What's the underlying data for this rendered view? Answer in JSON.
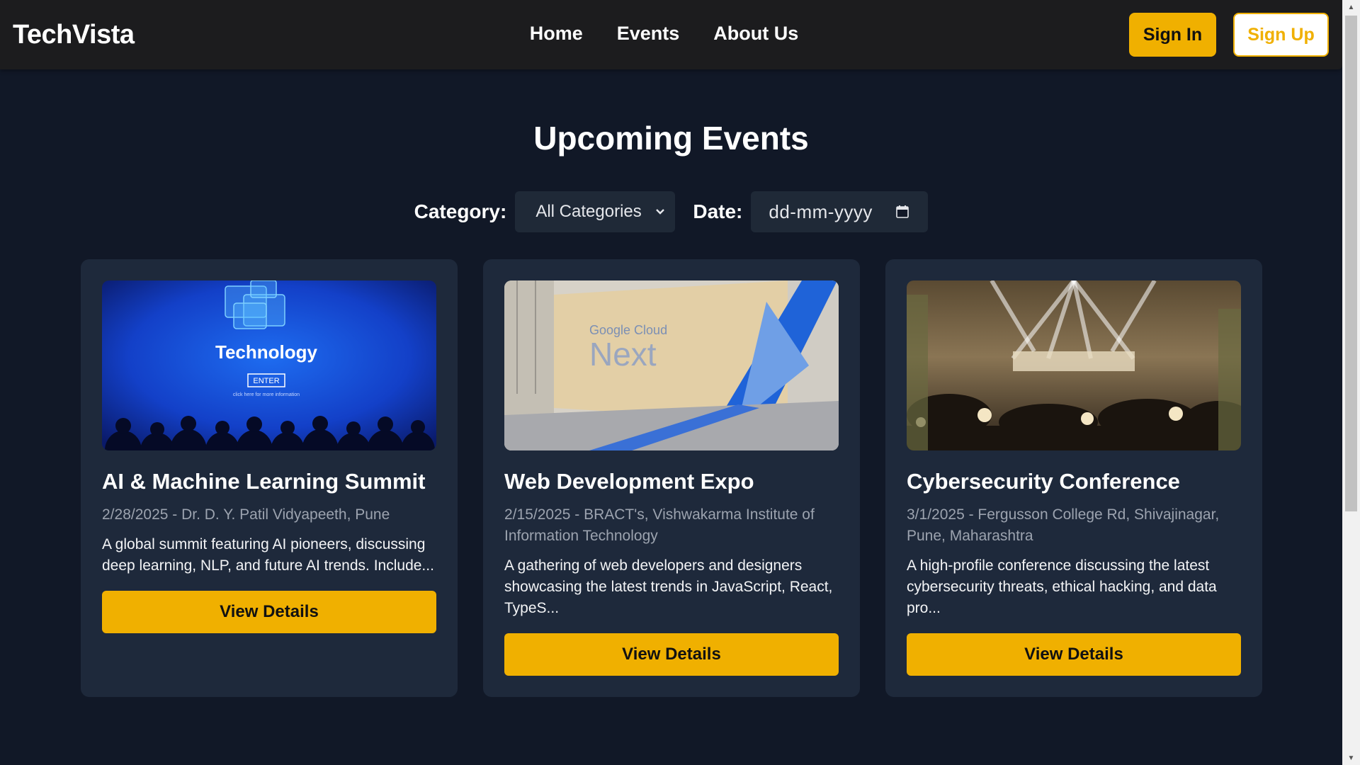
{
  "nav": {
    "logo": "TechVista",
    "links": [
      "Home",
      "Events",
      "About Us"
    ],
    "sign_in": "Sign In",
    "sign_up": "Sign Up"
  },
  "main": {
    "heading": "Upcoming Events",
    "filters": {
      "category_label": "Category:",
      "category_value": "All Categories",
      "date_label": "Date:",
      "date_placeholder": "dd-mm-yyyy"
    }
  },
  "events": [
    {
      "title": "AI & Machine Learning Summit",
      "meta": "2/28/2025 - Dr. D. Y. Patil Vidyapeeth, Pune",
      "description": "A global summit featuring AI pioneers, discussing deep learning, NLP, and future AI trends. Include...",
      "button": "View Details",
      "image_text": "Technology",
      "image_button": "ENTER",
      "image_caption": "click here for more information"
    },
    {
      "title": "Web Development Expo",
      "meta": "2/15/2025 - BRACT's, Vishwakarma Institute of Information Technology",
      "description": "A gathering of web developers and designers showcasing the latest trends in JavaScript, React, TypeS...",
      "button": "View Details",
      "image_brand": "Google Cloud",
      "image_text": "Next"
    },
    {
      "title": "Cybersecurity Conference",
      "meta": "3/1/2025 - Fergusson College Rd, Shivajinagar, Pune, Maharashtra",
      "description": "A high-profile conference discussing the latest cybersecurity threats, ethical hacking, and data pro...",
      "button": "View Details"
    }
  ],
  "colors": {
    "accent": "#f0b000",
    "background": "#111827",
    "card": "#1e293b",
    "navbar": "#1c1c1e"
  }
}
